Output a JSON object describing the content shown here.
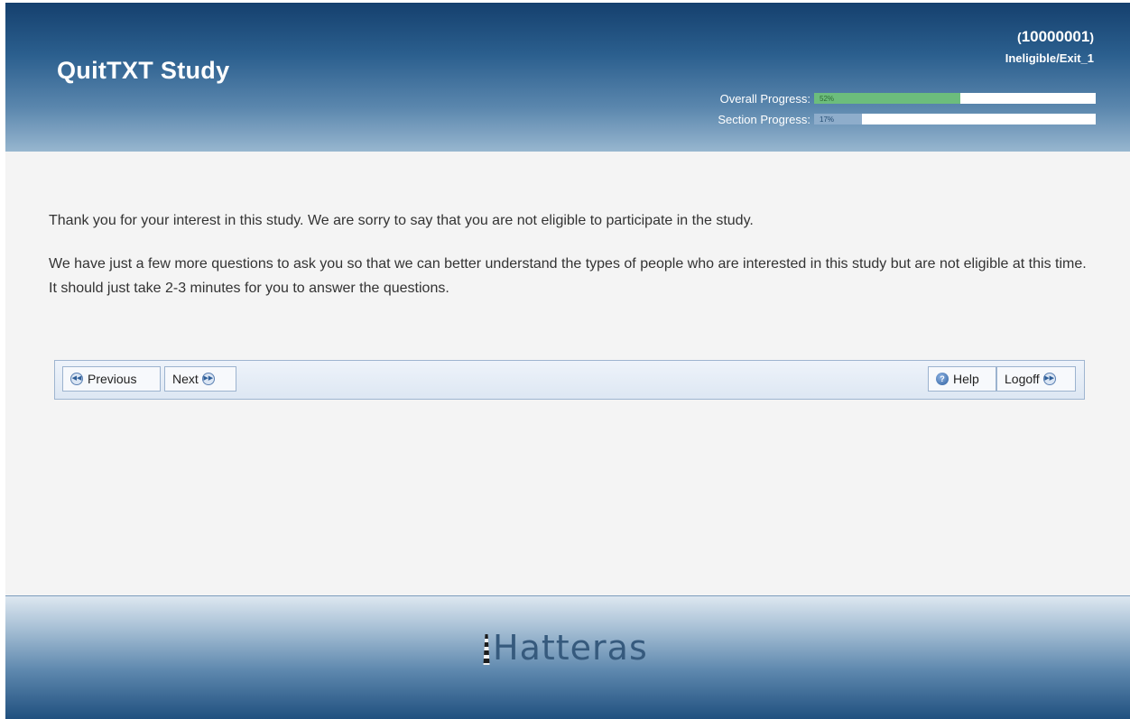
{
  "header": {
    "title": "QuitTXT Study",
    "participant_id": "10000001",
    "paren_open": "(",
    "paren_close": ")",
    "status": "Ineligible/Exit_1",
    "overall_progress": {
      "label": "Overall Progress:",
      "percent_text": "52%",
      "value": 0.52,
      "color": "#6cbd7c"
    },
    "section_progress": {
      "label": "Section Progress:",
      "percent_text": "17%",
      "value": 0.17,
      "color": "#8eadcb"
    }
  },
  "content": {
    "paragraph_1": "Thank you for your interest in this study. We are sorry to say that you are not eligible to participate in the study.",
    "paragraph_2": "We have just a few more questions to ask you so that we can better understand the types of people who are interested in this study but are not eligible at this time. It should just take 2-3 minutes for you to answer the questions."
  },
  "navbar": {
    "previous_label": "Previous",
    "next_label": "Next",
    "help_label": "Help",
    "logoff_label": "Logoff"
  },
  "footer": {
    "logo_text": "Hatteras"
  },
  "icons": {
    "previous": "rewind-circle-icon",
    "next": "fast-forward-circle-icon",
    "help": "help-circle-icon",
    "logoff": "fast-forward-circle-icon"
  }
}
